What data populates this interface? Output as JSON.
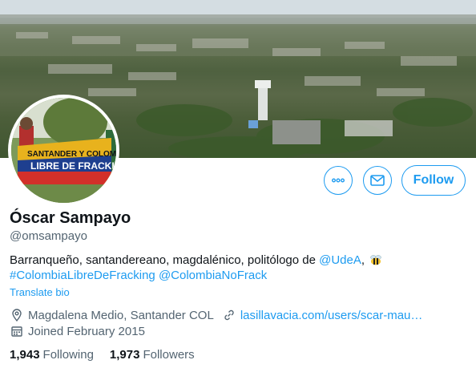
{
  "banner": {
    "description_icon": "city-aerial-photo"
  },
  "avatar": {
    "icon": "avatar-photo",
    "banner_text_1": "SANTANDER Y COLOMBIA",
    "banner_text_2": "LIBRE DE FRACKING"
  },
  "actions": {
    "more_icon": "more-dots-icon",
    "message_icon": "mail-icon",
    "follow_label": "Follow"
  },
  "profile": {
    "name": "Óscar Sampayo",
    "handle": "@omsampayo",
    "bio_text": "Barranqueño, santandereano, magdalénico, politólogo de",
    "bio_mention_1": "@UdeA",
    "bio_comma": ",",
    "bio_hashtag": "#ColombiaLibreDeFracking",
    "bio_mention_2": "@ColombiaNoFrack",
    "translate_label": "Translate bio",
    "location": "Magdalena Medio, Santander COL",
    "website": "lasillavacia.com/users/scar-mau…",
    "joined": "Joined February 2015",
    "following_count": "1,943",
    "following_label": "Following",
    "followers_count": "1,973",
    "followers_label": "Followers"
  },
  "colors": {
    "accent": "#1d9bf0",
    "secondary_text": "#536471",
    "primary_text": "#0f1419"
  }
}
